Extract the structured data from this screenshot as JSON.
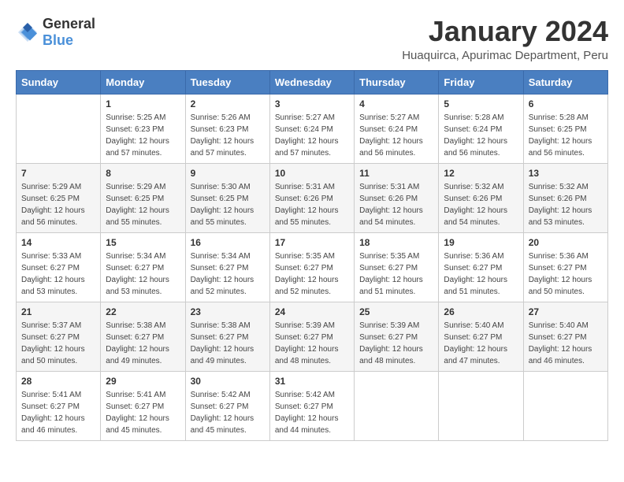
{
  "header": {
    "logo_general": "General",
    "logo_blue": "Blue",
    "title": "January 2024",
    "subtitle": "Huaquirca, Apurimac Department, Peru"
  },
  "days_of_week": [
    "Sunday",
    "Monday",
    "Tuesday",
    "Wednesday",
    "Thursday",
    "Friday",
    "Saturday"
  ],
  "weeks": [
    [
      {
        "day": "",
        "sunrise": "",
        "sunset": "",
        "daylight": ""
      },
      {
        "day": "1",
        "sunrise": "5:25 AM",
        "sunset": "6:23 PM",
        "daylight": "12 hours and 57 minutes."
      },
      {
        "day": "2",
        "sunrise": "5:26 AM",
        "sunset": "6:23 PM",
        "daylight": "12 hours and 57 minutes."
      },
      {
        "day": "3",
        "sunrise": "5:27 AM",
        "sunset": "6:24 PM",
        "daylight": "12 hours and 57 minutes."
      },
      {
        "day": "4",
        "sunrise": "5:27 AM",
        "sunset": "6:24 PM",
        "daylight": "12 hours and 56 minutes."
      },
      {
        "day": "5",
        "sunrise": "5:28 AM",
        "sunset": "6:24 PM",
        "daylight": "12 hours and 56 minutes."
      },
      {
        "day": "6",
        "sunrise": "5:28 AM",
        "sunset": "6:25 PM",
        "daylight": "12 hours and 56 minutes."
      }
    ],
    [
      {
        "day": "7",
        "sunrise": "5:29 AM",
        "sunset": "6:25 PM",
        "daylight": "12 hours and 56 minutes."
      },
      {
        "day": "8",
        "sunrise": "5:29 AM",
        "sunset": "6:25 PM",
        "daylight": "12 hours and 55 minutes."
      },
      {
        "day": "9",
        "sunrise": "5:30 AM",
        "sunset": "6:25 PM",
        "daylight": "12 hours and 55 minutes."
      },
      {
        "day": "10",
        "sunrise": "5:31 AM",
        "sunset": "6:26 PM",
        "daylight": "12 hours and 55 minutes."
      },
      {
        "day": "11",
        "sunrise": "5:31 AM",
        "sunset": "6:26 PM",
        "daylight": "12 hours and 54 minutes."
      },
      {
        "day": "12",
        "sunrise": "5:32 AM",
        "sunset": "6:26 PM",
        "daylight": "12 hours and 54 minutes."
      },
      {
        "day": "13",
        "sunrise": "5:32 AM",
        "sunset": "6:26 PM",
        "daylight": "12 hours and 53 minutes."
      }
    ],
    [
      {
        "day": "14",
        "sunrise": "5:33 AM",
        "sunset": "6:27 PM",
        "daylight": "12 hours and 53 minutes."
      },
      {
        "day": "15",
        "sunrise": "5:34 AM",
        "sunset": "6:27 PM",
        "daylight": "12 hours and 53 minutes."
      },
      {
        "day": "16",
        "sunrise": "5:34 AM",
        "sunset": "6:27 PM",
        "daylight": "12 hours and 52 minutes."
      },
      {
        "day": "17",
        "sunrise": "5:35 AM",
        "sunset": "6:27 PM",
        "daylight": "12 hours and 52 minutes."
      },
      {
        "day": "18",
        "sunrise": "5:35 AM",
        "sunset": "6:27 PM",
        "daylight": "12 hours and 51 minutes."
      },
      {
        "day": "19",
        "sunrise": "5:36 AM",
        "sunset": "6:27 PM",
        "daylight": "12 hours and 51 minutes."
      },
      {
        "day": "20",
        "sunrise": "5:36 AM",
        "sunset": "6:27 PM",
        "daylight": "12 hours and 50 minutes."
      }
    ],
    [
      {
        "day": "21",
        "sunrise": "5:37 AM",
        "sunset": "6:27 PM",
        "daylight": "12 hours and 50 minutes."
      },
      {
        "day": "22",
        "sunrise": "5:38 AM",
        "sunset": "6:27 PM",
        "daylight": "12 hours and 49 minutes."
      },
      {
        "day": "23",
        "sunrise": "5:38 AM",
        "sunset": "6:27 PM",
        "daylight": "12 hours and 49 minutes."
      },
      {
        "day": "24",
        "sunrise": "5:39 AM",
        "sunset": "6:27 PM",
        "daylight": "12 hours and 48 minutes."
      },
      {
        "day": "25",
        "sunrise": "5:39 AM",
        "sunset": "6:27 PM",
        "daylight": "12 hours and 48 minutes."
      },
      {
        "day": "26",
        "sunrise": "5:40 AM",
        "sunset": "6:27 PM",
        "daylight": "12 hours and 47 minutes."
      },
      {
        "day": "27",
        "sunrise": "5:40 AM",
        "sunset": "6:27 PM",
        "daylight": "12 hours and 46 minutes."
      }
    ],
    [
      {
        "day": "28",
        "sunrise": "5:41 AM",
        "sunset": "6:27 PM",
        "daylight": "12 hours and 46 minutes."
      },
      {
        "day": "29",
        "sunrise": "5:41 AM",
        "sunset": "6:27 PM",
        "daylight": "12 hours and 45 minutes."
      },
      {
        "day": "30",
        "sunrise": "5:42 AM",
        "sunset": "6:27 PM",
        "daylight": "12 hours and 45 minutes."
      },
      {
        "day": "31",
        "sunrise": "5:42 AM",
        "sunset": "6:27 PM",
        "daylight": "12 hours and 44 minutes."
      },
      {
        "day": "",
        "sunrise": "",
        "sunset": "",
        "daylight": ""
      },
      {
        "day": "",
        "sunrise": "",
        "sunset": "",
        "daylight": ""
      },
      {
        "day": "",
        "sunrise": "",
        "sunset": "",
        "daylight": ""
      }
    ]
  ],
  "labels": {
    "sunrise_prefix": "Sunrise: ",
    "sunset_prefix": "Sunset: ",
    "daylight_prefix": "Daylight: "
  }
}
